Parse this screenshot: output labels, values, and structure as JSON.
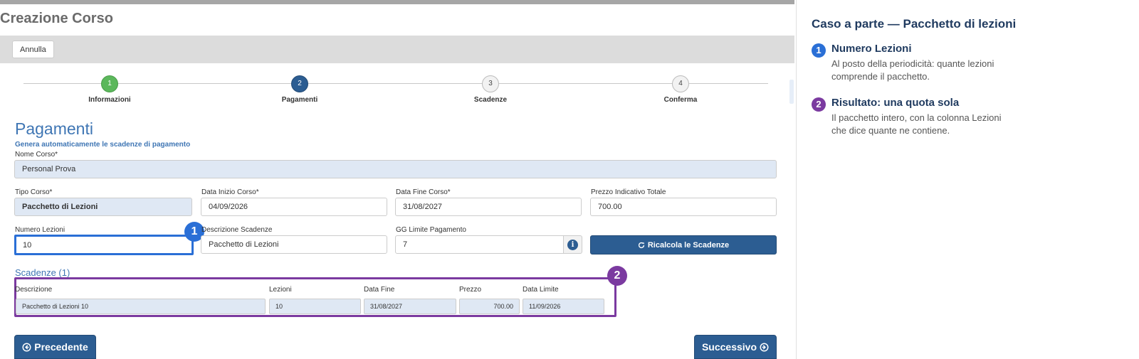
{
  "page": {
    "title": "Creazione Corso",
    "cancel_label": "Annulla"
  },
  "wizard": {
    "steps": [
      {
        "number": "1",
        "label": "Informazioni",
        "state": "done"
      },
      {
        "number": "2",
        "label": "Pagamenti",
        "state": "active"
      },
      {
        "number": "3",
        "label": "Scadenze",
        "state": "pending"
      },
      {
        "number": "4",
        "label": "Conferma",
        "state": "pending"
      }
    ]
  },
  "section": {
    "title": "Pagamenti",
    "subtitle": "Genera automaticamente le scadenze di pagamento"
  },
  "form": {
    "nome_corso": {
      "label": "Nome Corso*",
      "value": "Personal Prova"
    },
    "tipo_corso": {
      "label": "Tipo Corso*",
      "value": "Pacchetto di Lezioni"
    },
    "data_inizio": {
      "label": "Data Inizio Corso*",
      "value": "04/09/2026"
    },
    "data_fine": {
      "label": "Data Fine Corso*",
      "value": "31/08/2027"
    },
    "prezzo_totale": {
      "label": "Prezzo Indicativo Totale",
      "value": "700.00"
    },
    "numero_lezioni": {
      "label": "Numero Lezioni",
      "value": "10"
    },
    "descrizione_scadenze": {
      "label": "Descrizione Scadenze",
      "value": "Pacchetto di Lezioni"
    },
    "gg_limite": {
      "label": "GG Limite Pagamento",
      "value": "7"
    },
    "info_icon_glyph": "i",
    "recalc_label": "Ricalcola le Scadenze"
  },
  "scadenze": {
    "title": "Scadenze (1)",
    "columns": [
      "Descrizione",
      "Lezioni",
      "Data Fine",
      "Prezzo",
      "Data Limite"
    ],
    "rows": [
      {
        "descrizione": "Pacchetto di Lezioni 10",
        "lezioni": "10",
        "data_fine": "31/08/2027",
        "prezzo": "700.00",
        "data_limite": "11/09/2026"
      }
    ]
  },
  "nav": {
    "prev_label": "Precedente",
    "next_label": "Successivo"
  },
  "callouts": {
    "badge1": "1",
    "badge2": "2"
  },
  "side_panel": {
    "title": "Caso a parte — Pacchetto di lezioni",
    "notes": [
      {
        "number": "1",
        "title": "Numero Lezioni",
        "text": "Al posto della periodicità: quante lezioni comprende il pacchetto."
      },
      {
        "number": "2",
        "title": "Risultato: una quota sola",
        "text": "Il pacchetto intero, con la colonna Lezioni che dice quante ne contiene."
      }
    ]
  },
  "colors": {
    "primary": "#2c5d92",
    "step_done": "#5cb85c",
    "highlight_blue": "#2a6fd6",
    "highlight_purple": "#7b3aa0",
    "readonly_bg": "#dfe8f4"
  },
  "icons": {
    "prev": "arrow-left-circle-icon",
    "next": "arrow-right-circle-icon",
    "recalc": "refresh-icon",
    "info": "info-icon"
  }
}
